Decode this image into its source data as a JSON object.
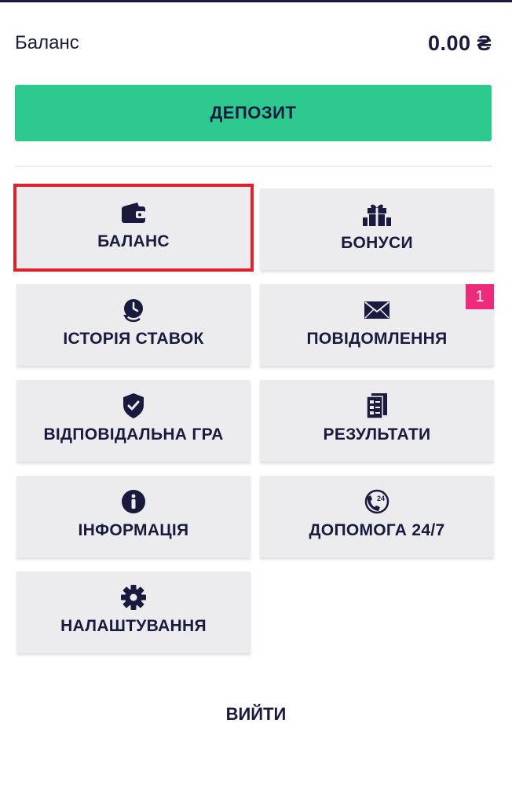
{
  "header": {
    "balance_label": "Баланс",
    "balance_amount": "0.00 ₴"
  },
  "deposit_label": "ДЕПОЗИТ",
  "menu": {
    "balance": "БАЛАНС",
    "bonuses": "БОНУСИ",
    "bet_history": "ІСТОРІЯ СТАВОК",
    "messages": "ПОВІДОМЛЕННЯ",
    "messages_badge": "1",
    "responsible_gaming": "ВІДПОВІДАЛЬНА ГРА",
    "results": "РЕЗУЛЬТАТИ",
    "information": "ІНФОРМАЦІЯ",
    "support": "ДОПОМОГА 24/7",
    "settings": "НАЛАШТУВАННЯ"
  },
  "logout_label": "ВИЙТИ",
  "colors": {
    "accent_green": "#2ec98f",
    "text_navy": "#1a1a3e",
    "tile_bg": "#ececef",
    "badge_pink": "#ee2a7b",
    "highlight_red": "#e0202a"
  },
  "icons": {
    "balance": "wallet-icon",
    "bonuses": "gift-icon",
    "bet_history": "clock-history-icon",
    "messages": "envelope-icon",
    "responsible_gaming": "shield-check-icon",
    "results": "document-list-icon",
    "information": "info-icon",
    "support": "phone-24-icon",
    "settings": "gear-icon"
  }
}
